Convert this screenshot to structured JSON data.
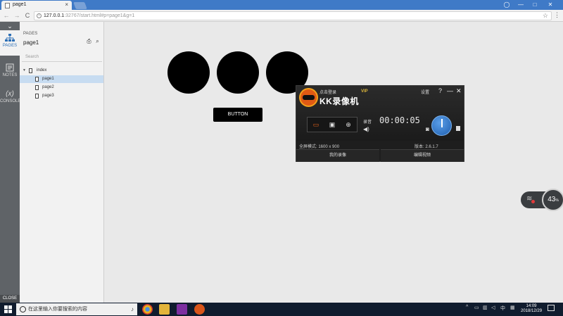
{
  "browser": {
    "tab_title": "page1",
    "tab_close": "×",
    "url_host": "127.0.0.1",
    "url_rest": ":32767/start.html#p=page1&g=1",
    "nav_back": "←",
    "nav_forward": "→",
    "nav_reload": "C",
    "star": "☆",
    "menu": "⋮",
    "win_user": "◯",
    "win_minimize": "—",
    "win_maximize": "□",
    "win_close": "✕"
  },
  "rail": {
    "collapse": "⌄",
    "items": [
      {
        "label": "PAGES",
        "icon": "sitemap-icon"
      },
      {
        "label": "NOTES",
        "icon": "notes-icon"
      },
      {
        "label": "CONSOLE",
        "icon": "variable-icon"
      }
    ],
    "variable_glyph": "(x)",
    "close": "CLOSE"
  },
  "pages_panel": {
    "title": "PAGES",
    "current_page": "page1",
    "search_placeholder": "Search",
    "tree": [
      {
        "label": "index",
        "level": 0,
        "selected": false
      },
      {
        "label": "page1",
        "level": 1,
        "selected": true
      },
      {
        "label": "page2",
        "level": 1,
        "selected": false
      },
      {
        "label": "page3",
        "level": 1,
        "selected": false
      }
    ]
  },
  "canvas": {
    "button_label": "BUTTON"
  },
  "recorder": {
    "login": "点击登录",
    "vip": "VIP",
    "name": "KK录像机",
    "settings": "设置",
    "help": "?",
    "minimize": "—",
    "close": "✕",
    "mic_label": "录音",
    "timer": "00:00:05",
    "resolution": "全屏模式: 1600 x 900",
    "version": "版本: 2.6.1.7",
    "my_recordings": "我的录像",
    "edit_video": "编辑视频"
  },
  "network": {
    "percent": "43",
    "unit": "%"
  },
  "taskbar": {
    "search_placeholder": "在这里输入你要搜索的内容",
    "time": "14:09",
    "date": "2018/12/29",
    "tray_caret": "^",
    "apps": [
      {
        "name": "chrome",
        "color": "#e8b01c"
      },
      {
        "name": "explorer",
        "color": "#e3b43a"
      },
      {
        "name": "axure",
        "color": "#7d2fa0"
      },
      {
        "name": "kk",
        "color": "#d9551a"
      }
    ]
  }
}
